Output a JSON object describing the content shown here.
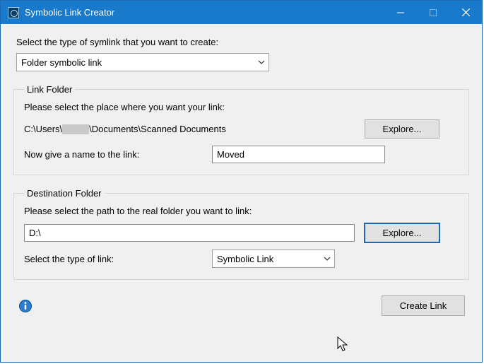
{
  "window": {
    "title": "Symbolic Link Creator"
  },
  "top": {
    "instruction": "Select the type of symlink that you want to create:",
    "symlink_type": "Folder symbolic link"
  },
  "link_folder": {
    "legend": "Link Folder",
    "place_label": "Please select the place where you want your link:",
    "place_value_prefix": "C:\\Users\\",
    "place_value_suffix": "\\Documents\\Scanned Documents",
    "explore": "Explore...",
    "name_label": "Now give a name to the link:",
    "name_value": "Moved"
  },
  "dest_folder": {
    "legend": "Destination Folder",
    "path_label": "Please select the path to the real folder you want to link:",
    "path_value": "D:\\",
    "explore": "Explore...",
    "type_label": "Select the type of link:",
    "type_value": "Symbolic Link"
  },
  "footer": {
    "create": "Create Link"
  }
}
